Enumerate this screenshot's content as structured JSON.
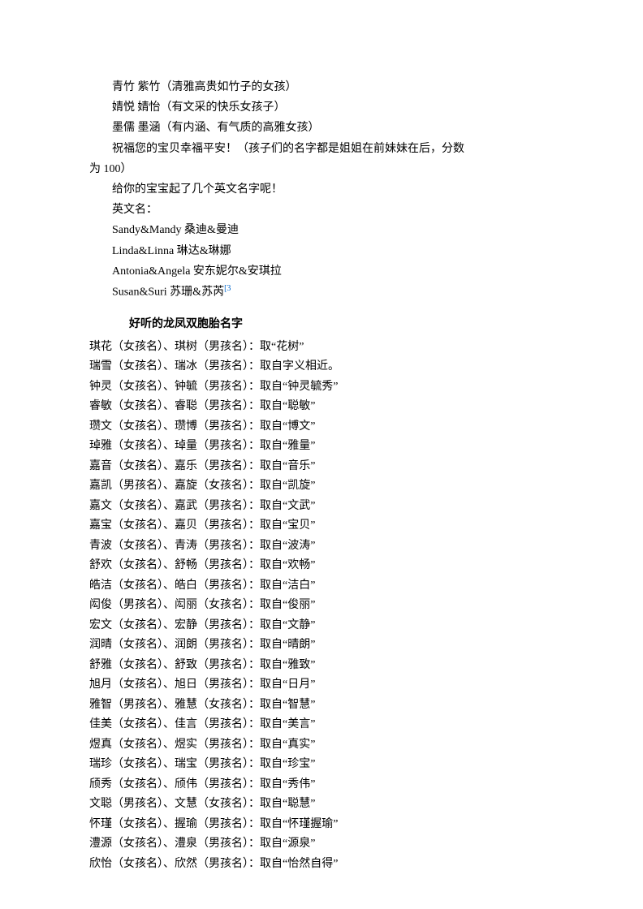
{
  "intro_lines": [
    "青竹  紫竹（清雅高贵如竹子的女孩）",
    "婧悦  婧怡（有文采的快乐女孩子）",
    "墨儒  墨涵（有内涵、有气质的高雅女孩）",
    "祝福您的宝贝幸福平安！（孩子们的名字都是姐姐在前妹妹在后，分数"
  ],
  "intro_line_noindent": "为 100）",
  "more_lines": [
    "给你的宝宝起了几个英文名字呢！",
    "英文名：",
    "Sandy&Mandy 桑迪&曼迪",
    "Linda&Linna 琳达&琳娜",
    "Antonia&Angela 安东妮尔&安琪拉"
  ],
  "last_english_line": "Susan&Suri 苏珊&苏芮",
  "ref_mark": "[3",
  "section_title": "好听的龙凤双胞胎名字",
  "name_pairs": [
    "琪花（女孩名）、琪树（男孩名）：取“花树”",
    "瑞雪（女孩名）、瑞冰（男孩名）：取自字义相近。",
    "钟灵（女孩名）、钟毓（男孩名）：取自“钟灵毓秀”",
    "睿敏（女孩名）、睿聪（男孩名）：取自“聪敏”",
    "瓒文（女孩名）、瓒博（男孩名）：取自“博文”",
    "琸雅（女孩名）、琸量（男孩名）：取自“雅量”",
    "嘉音（女孩名）、嘉乐（男孩名）：取自“音乐”",
    "嘉凯（男孩名）、嘉旋（女孩名）：取自“凯旋”",
    "嘉文（女孩名）、嘉武（男孩名）：取自“文武”",
    "嘉宝（女孩名）、嘉贝（男孩名）：取自“宝贝”",
    "青波（女孩名）、青涛（男孩名）：取自“波涛”",
    "舒欢（女孩名）、舒畅（男孩名）：取自“欢畅”",
    "皓洁（女孩名）、皓白（男孩名）：取自“洁白”",
    "闳俊（男孩名）、闳丽（女孩名）：取自“俊丽”",
    "宏文（女孩名）、宏静（男孩名）：取自“文静”",
    "润晴（女孩名）、润朗（男孩名）：取自“晴朗”",
    "舒雅（女孩名）、舒致（男孩名）：取自“雅致”",
    "旭月（女孩名）、旭日（男孩名）：取自“日月”",
    "雅智（男孩名）、雅慧（女孩名）：取自“智慧”",
    "佳美（女孩名）、佳言（男孩名）：取自“美言”",
    "煜真（女孩名）、煜实（男孩名）：取自“真实”",
    "瑞珍（女孩名）、瑞宝（男孩名）：取自“珍宝”",
    "颀秀（女孩名）、颀伟（男孩名）：取自“秀伟”",
    "文聪（男孩名）、文慧（女孩名）：取自“聪慧”",
    "怀瑾（女孩名）、握瑜（男孩名）：取自“怀瑾握瑜”",
    "澧源（女孩名）、澧泉（男孩名）：取自“源泉”",
    "欣怡（女孩名）、欣然（男孩名）：取自“怡然自得”"
  ]
}
